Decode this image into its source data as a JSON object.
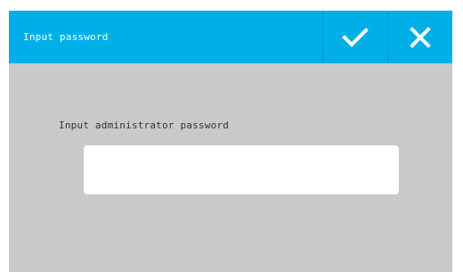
{
  "dialog": {
    "title": "Input password",
    "prompt": "Input administrator password",
    "password_value": "",
    "confirm_icon": "check-icon",
    "cancel_icon": "close-icon"
  },
  "colors": {
    "header": "#00aee8",
    "body": "#c9c9c9",
    "input": "#ffffff",
    "icon": "#ffffff"
  }
}
